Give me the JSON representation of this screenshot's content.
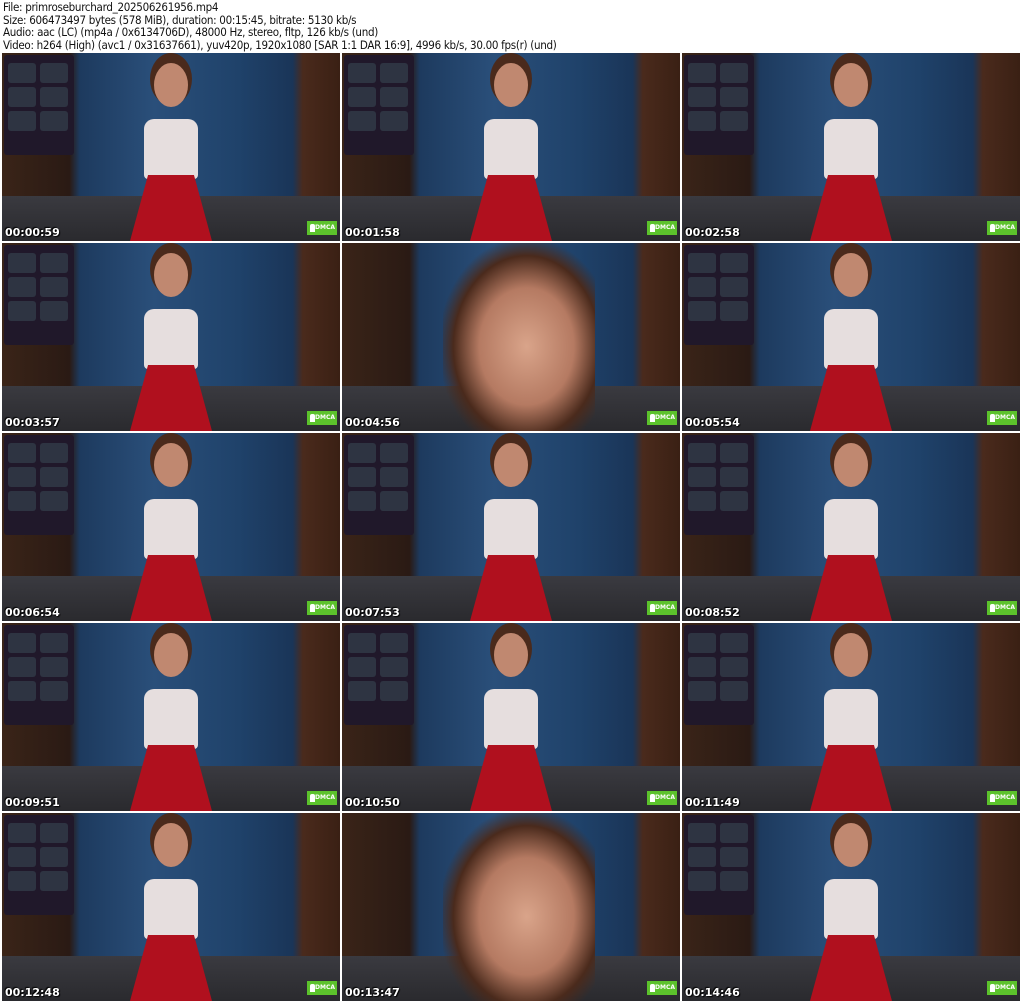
{
  "info": {
    "file": "File: primroseburchard_202506261956.mp4",
    "size": "Size: 606473497 bytes (578 MiB), duration: 00:15:45, bitrate: 5130 kb/s",
    "audio": "Audio: aac (LC) (mp4a / 0x6134706D), 48000 Hz, stereo, fltp, 126 kb/s (und)",
    "video": "Video: h264 (High) (avc1 / 0x31637661), yuv420p, 1920x1080 [SAR 1:1 DAR 16:9], 4996 kb/s, 30.00 fps(r) (und)"
  },
  "badge": "DMCA",
  "thumbs": [
    {
      "time": "00:00:59",
      "close": false
    },
    {
      "time": "00:01:58",
      "close": false
    },
    {
      "time": "00:02:58",
      "close": false
    },
    {
      "time": "00:03:57",
      "close": false
    },
    {
      "time": "00:04:56",
      "close": true
    },
    {
      "time": "00:05:54",
      "close": false
    },
    {
      "time": "00:06:54",
      "close": false
    },
    {
      "time": "00:07:53",
      "close": false
    },
    {
      "time": "00:08:52",
      "close": false
    },
    {
      "time": "00:09:51",
      "close": false
    },
    {
      "time": "00:10:50",
      "close": false
    },
    {
      "time": "00:11:49",
      "close": false
    },
    {
      "time": "00:12:48",
      "close": false
    },
    {
      "time": "00:13:47",
      "close": true
    },
    {
      "time": "00:14:46",
      "close": false
    }
  ]
}
